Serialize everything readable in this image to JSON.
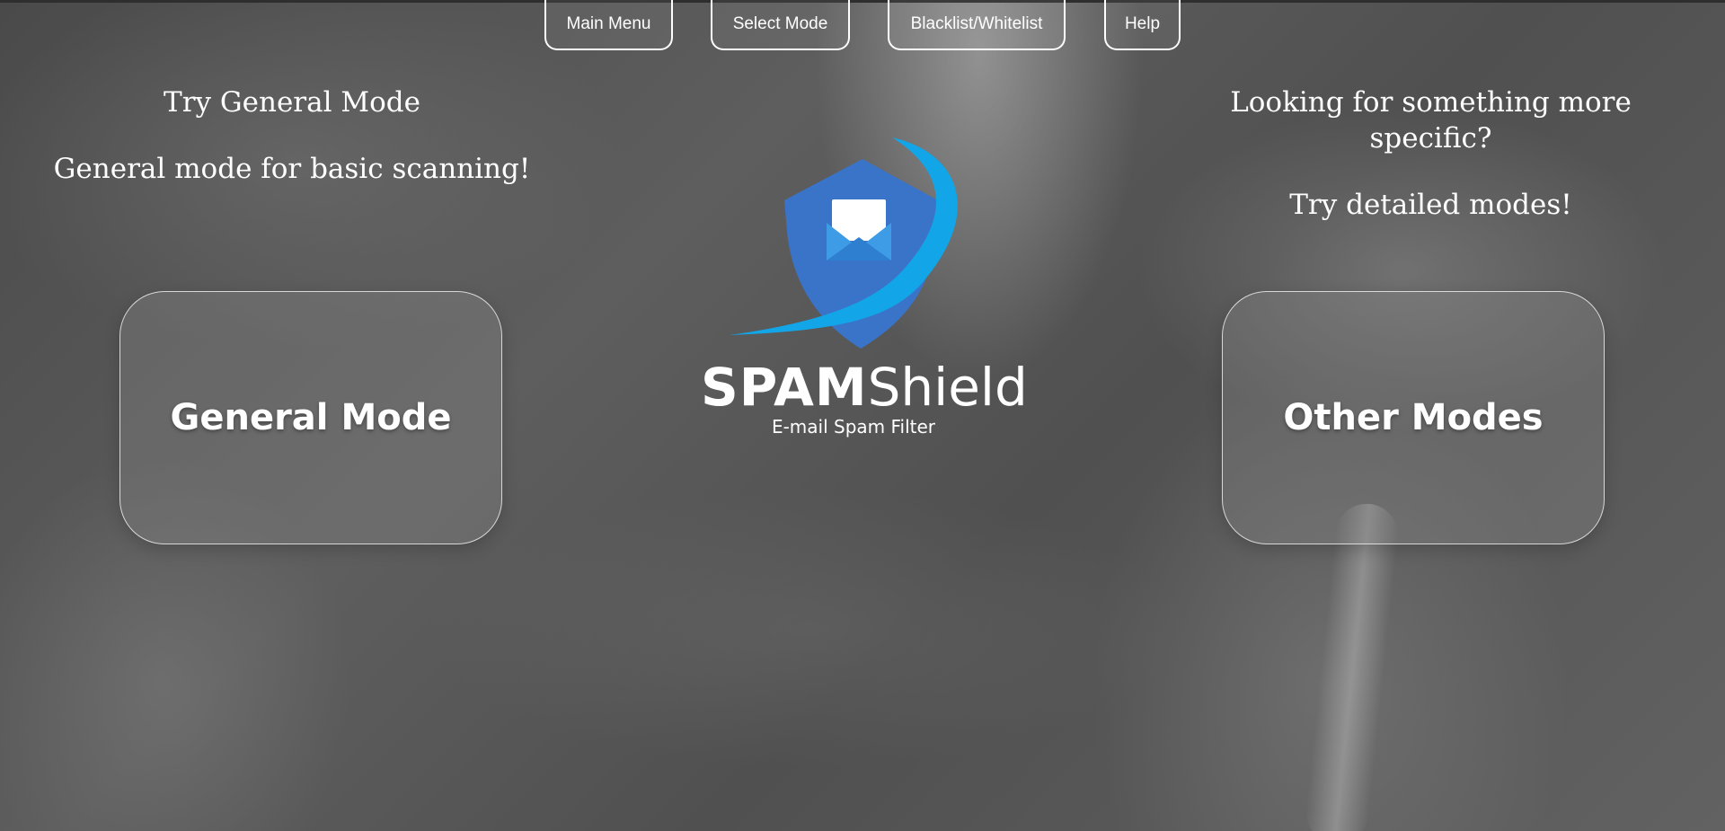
{
  "nav": {
    "main_menu": "Main Menu",
    "select_mode": "Select Mode",
    "blacklist_whitelist": "Blacklist/Whitelist",
    "help": "Help"
  },
  "left": {
    "heading": "Try General Mode",
    "subtext": "General mode for basic scanning!",
    "button_label": "General Mode"
  },
  "right": {
    "heading": "Looking for something more specific?",
    "subtext": "Try detailed modes!",
    "button_label": "Other Modes"
  },
  "brand": {
    "name_bold": "SPAM",
    "name_regular": "Shield",
    "tagline": "E-mail Spam Filter",
    "icon": "shield-envelope-icon",
    "colors": {
      "shield": "#3a74c9",
      "swoosh": "#12a6e8",
      "envelope_light": "#ffffff",
      "envelope_blue": "#3e9be6"
    }
  },
  "colors": {
    "background": "#555555",
    "text": "#ffffff"
  }
}
